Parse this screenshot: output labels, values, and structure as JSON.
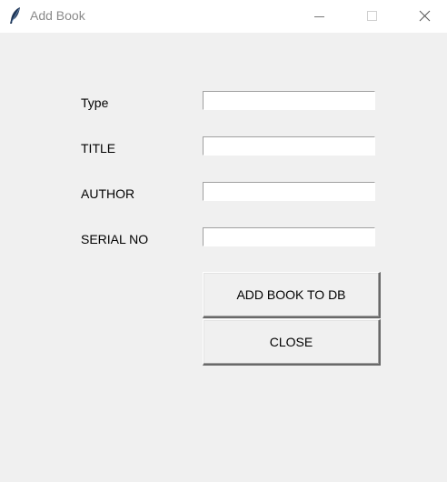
{
  "window": {
    "title": "Add Book",
    "icon": "feather-icon",
    "controls": {
      "minimize_icon": "minimize-icon",
      "maximize_icon": "maximize-icon",
      "close_icon": "close-icon"
    }
  },
  "form": {
    "fields": [
      {
        "label": "Type",
        "value": ""
      },
      {
        "label": "TITLE",
        "value": ""
      },
      {
        "label": "AUTHOR",
        "value": ""
      },
      {
        "label": "SERIAL NO",
        "value": ""
      }
    ],
    "add_button_label": "ADD BOOK TO DB",
    "close_button_label": "CLOSE"
  },
  "colors": {
    "window_background": "#f0f0f0",
    "titlebar_background": "#ffffff",
    "title_text": "#8a8a8a"
  }
}
